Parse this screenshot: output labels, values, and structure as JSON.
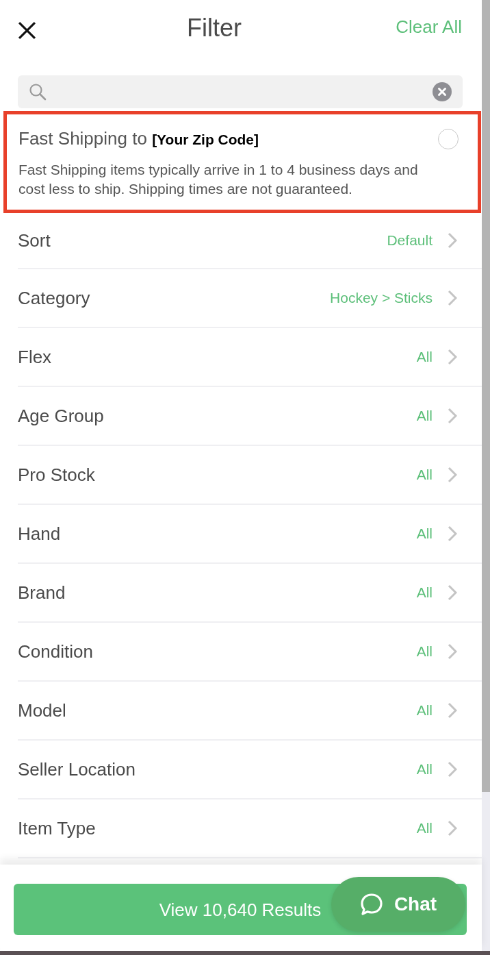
{
  "header": {
    "title": "Filter",
    "clear_button": "Clear All"
  },
  "fast_shipping": {
    "label": "Fast Shipping to **[Your Zip Code]**",
    "description": "Fast Shipping items typically arrive in 1 to 4 business days and cost less to ship. Shipping times are not guaranteed.",
    "checked": false
  },
  "filters": [
    {
      "label": "Sort",
      "value": "Default"
    },
    {
      "label": "Category",
      "value": "Hockey > Sticks"
    },
    {
      "label": "Flex",
      "value": "All"
    },
    {
      "label": "Age Group",
      "value": "All"
    },
    {
      "label": "Pro Stock",
      "value": "All"
    },
    {
      "label": "Hand",
      "value": "All"
    },
    {
      "label": "Brand",
      "value": "All"
    },
    {
      "label": "Condition",
      "value": "All"
    },
    {
      "label": "Model",
      "value": "All"
    },
    {
      "label": "Seller Location",
      "value": "All"
    },
    {
      "label": "Item Type",
      "value": "All"
    }
  ],
  "footer": {
    "results_button": "View 10,640 Results",
    "chat_button": "Chat"
  }
}
